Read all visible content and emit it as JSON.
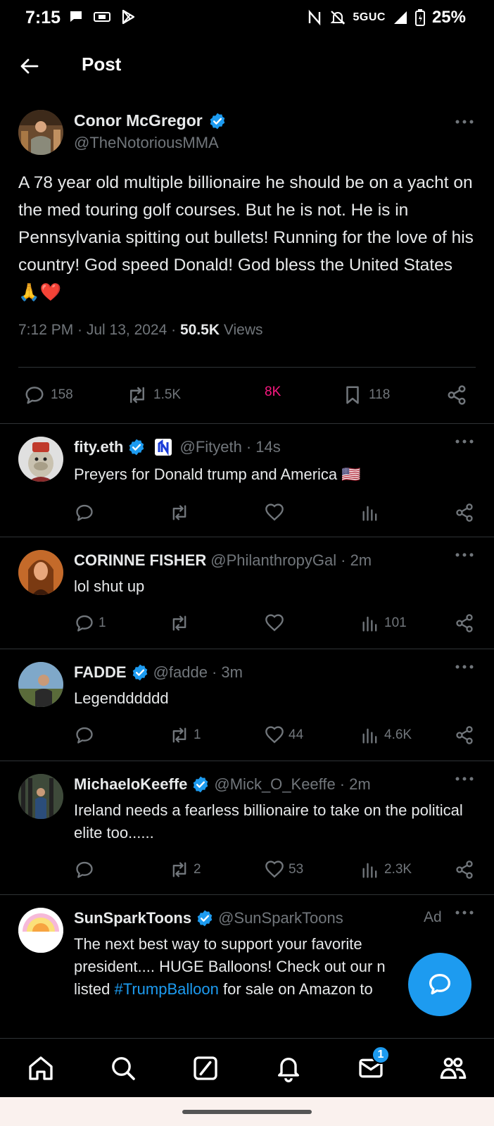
{
  "status_bar": {
    "time": "7:15",
    "network": "5GUC",
    "battery": "25%"
  },
  "header": {
    "title": "Post"
  },
  "main_post": {
    "name": "Conor McGregor",
    "handle": "@TheNotoriousMMA",
    "text": "A 78 year old multiple billionaire he should be on a yacht on the med touring golf courses. But he is not. He is in Pennsylvania spitting out bullets! Running for the love of his country! God speed Donald! God bless the United States 🙏❤️",
    "timestamp": "7:12 PM · Jul 13, 2024 · ",
    "views_count": "50.5K",
    "views_label": " Views",
    "replies": "158",
    "reposts": "1.5K",
    "likes": "8K",
    "bookmarks": "118"
  },
  "replies": [
    {
      "name": "fity.eth",
      "handle": "@Fityeth",
      "time": "· 14s",
      "text": "Preyers for Donald trump and America 🇺🇸",
      "reply_count": "",
      "repost_count": "",
      "like_count": "",
      "view_count": ""
    },
    {
      "name": "CORINNE FISHER",
      "handle": "@PhilanthropyGal",
      "time": "· 2m",
      "text": "lol shut up",
      "reply_count": "1",
      "repost_count": "",
      "like_count": "",
      "view_count": "101"
    },
    {
      "name": "FADDE",
      "handle": "@fadde",
      "time": "· 3m",
      "text": "Legendddddd",
      "reply_count": "",
      "repost_count": "1",
      "like_count": "44",
      "view_count": "4.6K"
    },
    {
      "name": "MichaeloKeeffe",
      "handle": "@Mick_O_Keeffe",
      "time": "· 2m",
      "text": "Ireland needs a fearless billionaire to take on the political elite too......",
      "reply_count": "",
      "repost_count": "2",
      "like_count": "53",
      "view_count": "2.3K"
    },
    {
      "name": "SunSparkToons",
      "handle": "@SunSparkToons",
      "ad_label": "Ad",
      "text_before": "The next best way to support your favorite president.... HUGE Balloons! Check out our n",
      "text_line3_prefix": "listed ",
      "hashtag": "#TrumpBalloon",
      "text_after": " for sale on Amazon to"
    }
  ],
  "bottom_nav": {
    "messages_badge": "1"
  },
  "colors": {
    "accent": "#1d9bf0",
    "like_active": "#f91880",
    "muted": "#71767b",
    "divider": "#2f3336"
  },
  "icons": [
    "back-arrow-icon",
    "more-icon",
    "verified-icon",
    "reply-icon",
    "repost-icon",
    "like-icon",
    "views-icon",
    "bookmark-icon",
    "share-icon",
    "home-icon",
    "search-icon",
    "grok-icon",
    "notifications-icon",
    "messages-icon",
    "communities-icon",
    "compose-reply-icon"
  ]
}
